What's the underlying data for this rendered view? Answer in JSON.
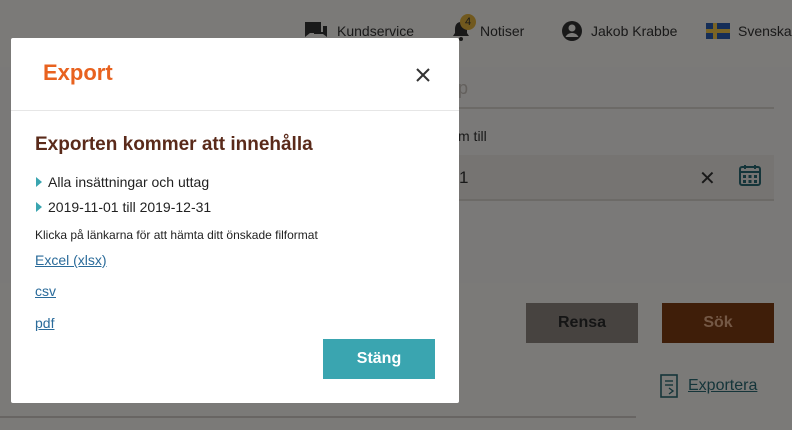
{
  "topbar": {
    "customer_service": "Kundservice",
    "notifications": {
      "label": "Notiser",
      "count": "4"
    },
    "user_name": "Jakob Krabbe",
    "language": "Svenska"
  },
  "background": {
    "to_date_label": "m till",
    "to_date_value": "1",
    "field_ghost_text": "p",
    "clear_button": "Rensa",
    "search_button": "Sök",
    "export_link": "Exportera"
  },
  "modal": {
    "title": "Export",
    "heading": "Exporten kommer att innehålla",
    "bullets": [
      "Alla insättningar och uttag",
      "2019-11-01 till 2019-12-31"
    ],
    "instruction": "Klicka på länkarna för att hämta ditt önskade filformat",
    "links": {
      "xlsx": "Excel (xlsx)",
      "csv": "csv",
      "pdf": "pdf"
    },
    "close_button": "Stäng"
  },
  "colors": {
    "accent_orange": "#e8621f",
    "teal": "#3aa5b0",
    "heading_brown": "#5a2a1a",
    "link_blue": "#2a6b9a"
  }
}
